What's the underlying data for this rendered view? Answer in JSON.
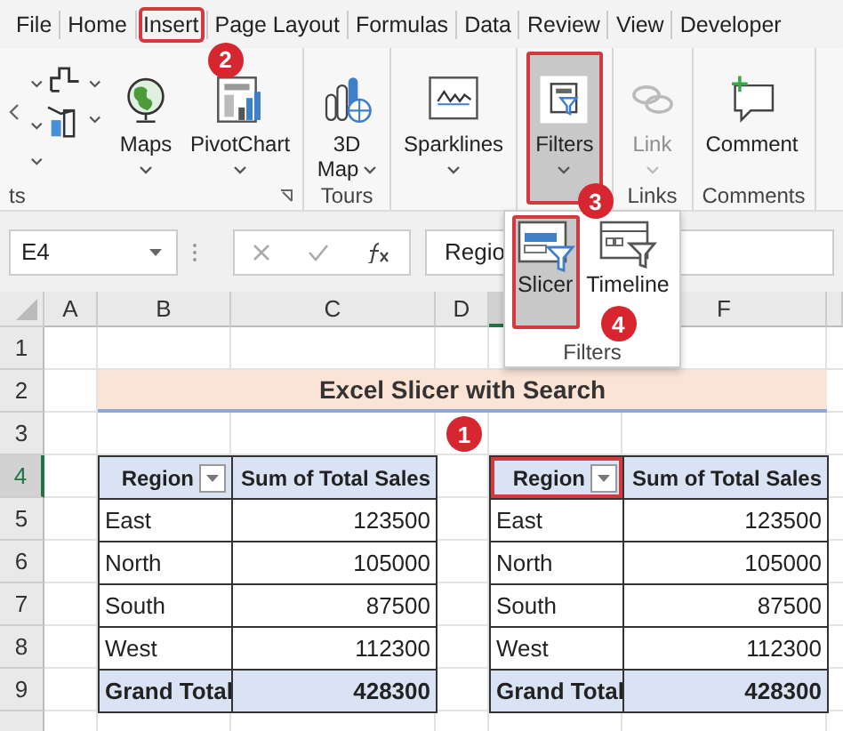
{
  "tabs": [
    {
      "label": "File",
      "highlighted": false
    },
    {
      "label": "Home",
      "highlighted": false
    },
    {
      "label": "Insert",
      "highlighted": true,
      "callout": "2"
    },
    {
      "label": "Page Layout",
      "highlighted": false
    },
    {
      "label": "Formulas",
      "highlighted": false
    },
    {
      "label": "Data",
      "highlighted": false
    },
    {
      "label": "Review",
      "highlighted": false
    },
    {
      "label": "View",
      "highlighted": false
    },
    {
      "label": "Developer",
      "highlighted": false
    }
  ],
  "ribbon": {
    "groups": [
      {
        "label": "ts",
        "launcher": true,
        "buttons": [
          {
            "kind": "icons"
          },
          {
            "kind": "large",
            "label": "Maps",
            "dropdown": true,
            "disabled": false,
            "pressed": false,
            "highlighted": false
          },
          {
            "kind": "large",
            "label": "PivotChart",
            "dropdown": true,
            "disabled": false,
            "pressed": false,
            "highlighted": false
          }
        ]
      },
      {
        "label": "Tours",
        "buttons": [
          {
            "kind": "wrapped",
            "label": "3D Map",
            "dropdown": true,
            "disabled": false,
            "pressed": false,
            "highlighted": false
          }
        ]
      },
      {
        "buttons": [
          {
            "kind": "large",
            "label": "Sparklines",
            "dropdown": true,
            "disabled": false,
            "pressed": false,
            "highlighted": false
          }
        ]
      },
      {
        "buttons": [
          {
            "kind": "large",
            "label": "Filters",
            "dropdown": true,
            "disabled": false,
            "pressed": true,
            "highlighted": true,
            "callout": "3"
          }
        ]
      },
      {
        "label": "Links",
        "buttons": [
          {
            "kind": "large",
            "label": "Link",
            "dropdown": true,
            "disabled": true,
            "pressed": false,
            "highlighted": false
          }
        ]
      },
      {
        "label": "Comments",
        "buttons": [
          {
            "kind": "large",
            "label": "Comment",
            "disabled": false,
            "pressed": false,
            "highlighted": false
          }
        ]
      }
    ]
  },
  "filters_menu": {
    "label": "Filters",
    "items": [
      {
        "label": "Slicer",
        "pressed": true,
        "highlighted": true,
        "callout": "4"
      },
      {
        "label": "Timeline",
        "pressed": false,
        "highlighted": false
      }
    ]
  },
  "formula_bar": {
    "name_box": "E4",
    "value": "Regio"
  },
  "sheet": {
    "columns": [
      {
        "label": "A",
        "selected": false
      },
      {
        "label": "B",
        "selected": false
      },
      {
        "label": "C",
        "selected": false
      },
      {
        "label": "D",
        "selected": false
      },
      {
        "selected": true
      },
      {
        "label": "F",
        "selected": false
      }
    ],
    "rows": [
      {
        "label": "1",
        "selected": false
      },
      {
        "label": "2",
        "selected": false
      },
      {
        "label": "3",
        "selected": false
      },
      {
        "label": "4",
        "selected": true
      },
      {
        "label": "5",
        "selected": false
      },
      {
        "label": "6",
        "selected": false
      },
      {
        "label": "7",
        "selected": false
      },
      {
        "label": "8",
        "selected": false
      },
      {
        "label": "9",
        "selected": false
      }
    ],
    "title": "Excel Slicer with Search",
    "pivot_tables": [
      {
        "headers": [
          {
            "label": "Region",
            "filter": true,
            "highlighted": false
          },
          {
            "label": "Sum of Total Sales",
            "highlighted": false
          }
        ],
        "rows": [
          [
            "East",
            "123500"
          ],
          [
            "North",
            "105000"
          ],
          [
            "South",
            "87500"
          ],
          [
            "West",
            "112300"
          ]
        ],
        "total": [
          "Grand Total",
          "428300"
        ]
      },
      {
        "headers": [
          {
            "label": "Region",
            "filter": true,
            "highlighted": true,
            "callout": "1"
          },
          {
            "label": "Sum of Total Sales",
            "highlighted": false
          }
        ],
        "rows": [
          [
            "East",
            "123500"
          ],
          [
            "North",
            "105000"
          ],
          [
            "South",
            "87500"
          ],
          [
            "West",
            "112300"
          ]
        ],
        "total": [
          "Grand Total",
          "428300"
        ]
      }
    ]
  }
}
